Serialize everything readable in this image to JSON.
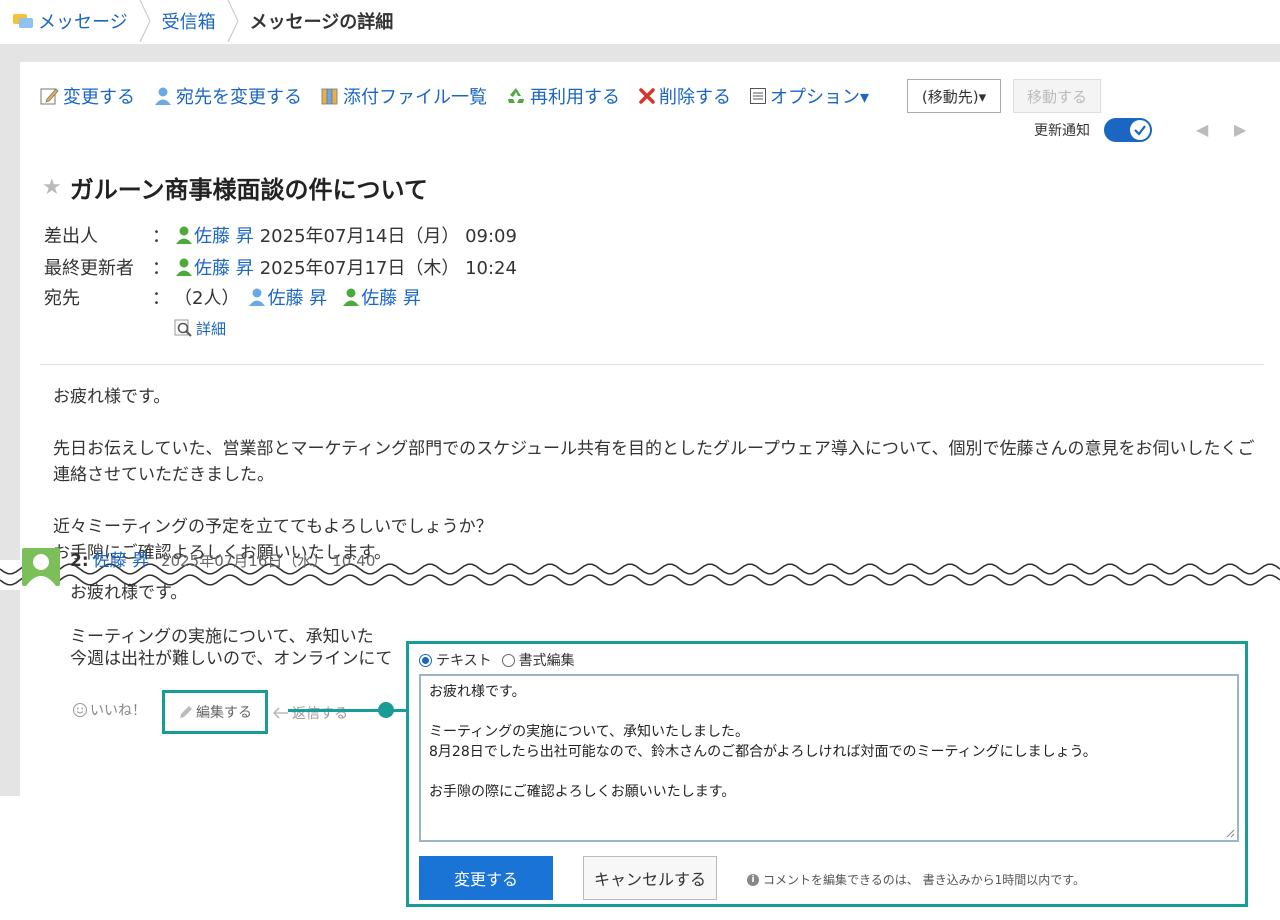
{
  "breadcrumb": {
    "items": [
      "メッセージ",
      "受信箱"
    ],
    "current": "メッセージの詳細"
  },
  "toolbar": {
    "change": "変更する",
    "change_recipients": "宛先を変更する",
    "attachments": "添付ファイル一覧",
    "reuse": "再利用する",
    "delete": "削除する",
    "options": "オプション▾",
    "move_dest": "(移動先)▾",
    "move_btn": "移動する"
  },
  "notify": {
    "label": "更新通知",
    "enabled": true
  },
  "message": {
    "title": "ガルーン商事様面談の件について",
    "sender_label": "差出人",
    "sender_name": "佐藤 昇",
    "sender_date": "2025年07月14日（月） 09:09",
    "updater_label": "最終更新者",
    "updater_name": "佐藤 昇",
    "updater_date": "2025年07月17日（木） 10:24",
    "to_label": "宛先",
    "to_count": "（2人）",
    "to_1": "佐藤 昇",
    "to_2": "佐藤 昇",
    "colon": "：",
    "detail": "詳細",
    "body": [
      "お疲れ様です。",
      "先日お伝えしていた、営業部とマーケティング部門でのスケジュール共有を目的としたグループウェア導入について、個別で佐藤さんの意見をお伺いしたくご連絡させていただきました。",
      "近々ミーティングの予定を立ててもよろしいでしょうか？<br>お手隙にご確認よろしくお願いいたします。"
    ]
  },
  "comment": {
    "num": "2:",
    "author": "佐藤 昇",
    "date": "2025年07月16日（水） 10:40",
    "line1": "お疲れ様です。",
    "line2": "ミーティングの実施について、承知いた",
    "line3": "今週は出社が難しいので、オンラインにて",
    "like": "いいね！",
    "edit": "編集する",
    "reply": "返信する"
  },
  "edit_panel": {
    "mode_text": "テキスト",
    "mode_rich": "書式編集",
    "editor_lines": [
      "お疲れ様です。",
      "",
      "ミーティングの実施について、承知いたしました。",
      "8月28日でしたら出社可能なので、鈴木さんのご都合がよろしければ対面でのミーティングにしましょう。",
      "",
      "お手隙の際にご確認よろしくお願いいたします。"
    ],
    "submit": "変更する",
    "cancel": "キャンセルする",
    "hint": "コメントを編集できるのは、 書き込みから1時間以内です。"
  },
  "colors": {
    "accent": "#1a66c2",
    "highlight": "#1a9c96",
    "primary_button": "#1a74d6"
  }
}
